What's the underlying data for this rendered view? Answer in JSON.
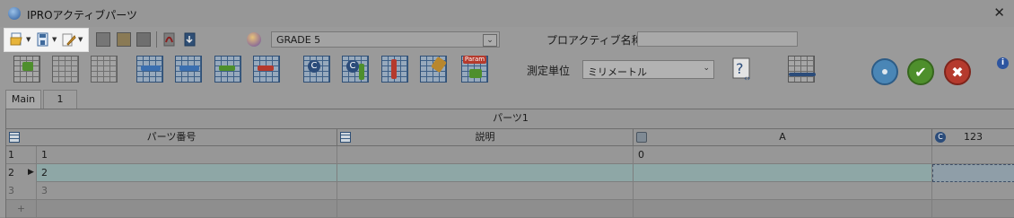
{
  "window": {
    "title": "IPROアクティブパーツ",
    "close_label": "X"
  },
  "toolbar_top": {
    "grade_value": "GRADE 5",
    "part_name_label": "プロアクティブ名称",
    "part_name_value": ""
  },
  "toolbar_main": {
    "unit_label": "測定単位",
    "unit_value": "ミリメートル",
    "param_label": "Param",
    "info_label": "i"
  },
  "tabs": [
    {
      "label": "Main"
    },
    {
      "label": "1"
    }
  ],
  "grid": {
    "group_header": "パーツ1",
    "columns": [
      {
        "label": "パーツ番号"
      },
      {
        "label": "説明"
      },
      {
        "label": "A"
      },
      {
        "label": "123"
      }
    ],
    "rows": [
      {
        "row_no": "1",
        "part_no": "1",
        "desc": "",
        "a": "0",
        "c123": ""
      },
      {
        "row_no": "2",
        "part_no": "2",
        "desc": "",
        "a": "",
        "c123": ""
      },
      {
        "row_no": "3",
        "part_no": "3",
        "desc": "",
        "a": "",
        "c123": ""
      }
    ],
    "new_row_marker": "+"
  },
  "colors": {
    "ok_green": "#4e8f2c",
    "cancel_red": "#b53a2d",
    "stop_blue": "#4a86b6",
    "selected_row": "#8ea7a6"
  }
}
